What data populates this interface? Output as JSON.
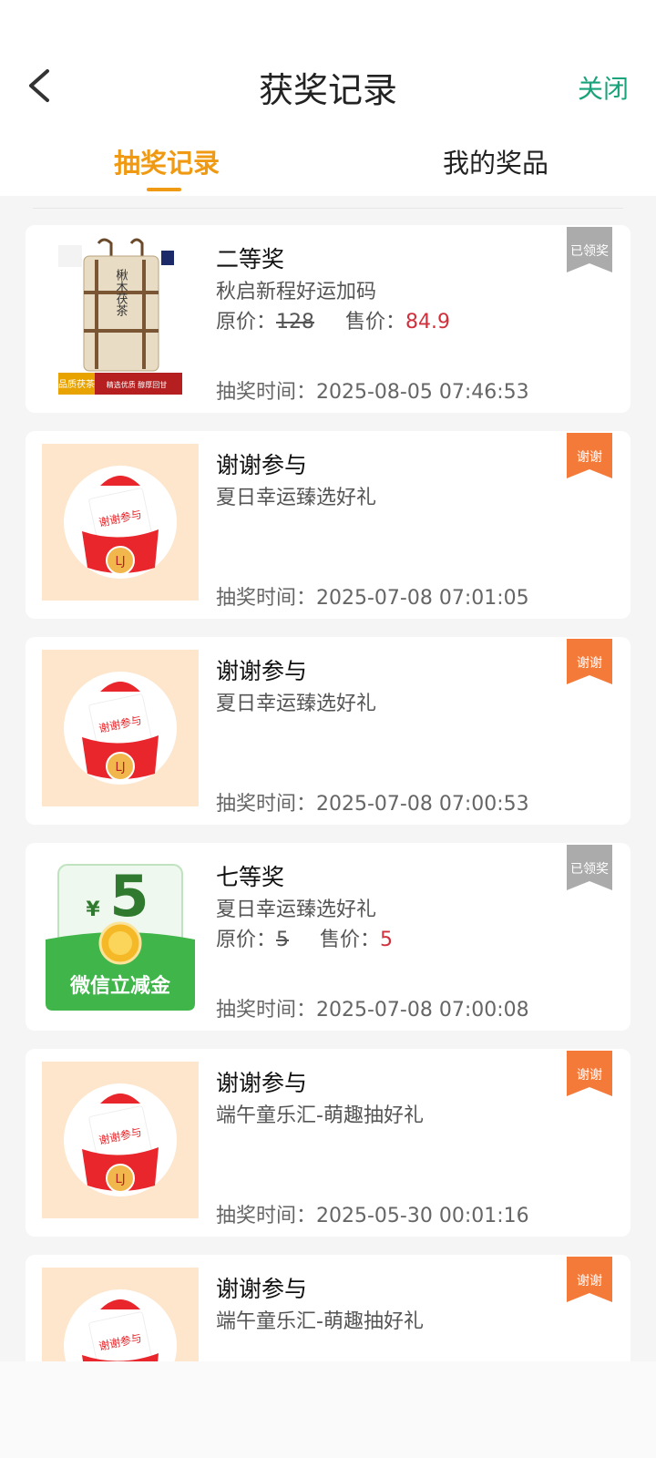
{
  "header": {
    "title": "获奖记录",
    "close_label": "关闭",
    "back_icon": "chevron-left-icon"
  },
  "tabs": [
    {
      "label": "抽奖记录",
      "active": true
    },
    {
      "label": "我的奖品",
      "active": false
    }
  ],
  "colors": {
    "accent": "#ef9a12",
    "close": "#1aa37a",
    "sale_price": "#d0303c",
    "badge_claimed": "#ababab",
    "badge_thanks": "#f47a3a"
  },
  "records": [
    {
      "prize": "二等奖",
      "campaign": "秋启新程好运加码",
      "orig_label": "原价：",
      "orig": "128",
      "sale_label": "售价：",
      "sale": "84.9",
      "time": "抽奖时间：2025-08-05 07:46:53",
      "badge": "已领奖",
      "image": "tea-package-image",
      "image_text": {
        "vertical": "楸木茯茶",
        "banner_top": "品质茯茶",
        "banner_sub": "精选优质 醇厚回甘"
      }
    },
    {
      "prize": "谢谢参与",
      "campaign": "夏日幸运臻选好礼",
      "time": "抽奖时间：2025-07-08 07:01:05",
      "badge": "谢谢",
      "image": "thanks-envelope-image",
      "image_text": {
        "card": "谢谢参与",
        "logo": "LJ"
      }
    },
    {
      "prize": "谢谢参与",
      "campaign": "夏日幸运臻选好礼",
      "time": "抽奖时间：2025-07-08 07:00:53",
      "badge": "谢谢",
      "image": "thanks-envelope-image",
      "image_text": {
        "card": "谢谢参与",
        "logo": "LJ"
      }
    },
    {
      "prize": "七等奖",
      "campaign": "夏日幸运臻选好礼",
      "orig_label": "原价：",
      "orig": "5",
      "sale_label": "售价：",
      "sale": "5",
      "time": "抽奖时间：2025-07-08 07:00:08",
      "badge": "已领奖",
      "image": "wechat-coupon-image",
      "image_text": {
        "currency": "¥",
        "amount": "5",
        "caption": "微信立减金"
      }
    },
    {
      "prize": "谢谢参与",
      "campaign": "端午童乐汇-萌趣抽好礼",
      "time": "抽奖时间：2025-05-30 00:01:16",
      "badge": "谢谢",
      "image": "thanks-envelope-image",
      "image_text": {
        "card": "谢谢参与",
        "logo": "LJ"
      }
    },
    {
      "prize": "谢谢参与",
      "campaign": "端午童乐汇-萌趣抽好礼",
      "time": "",
      "badge": "谢谢",
      "image": "thanks-envelope-image",
      "image_text": {
        "card": "谢谢参与",
        "logo": "LJ"
      }
    }
  ]
}
